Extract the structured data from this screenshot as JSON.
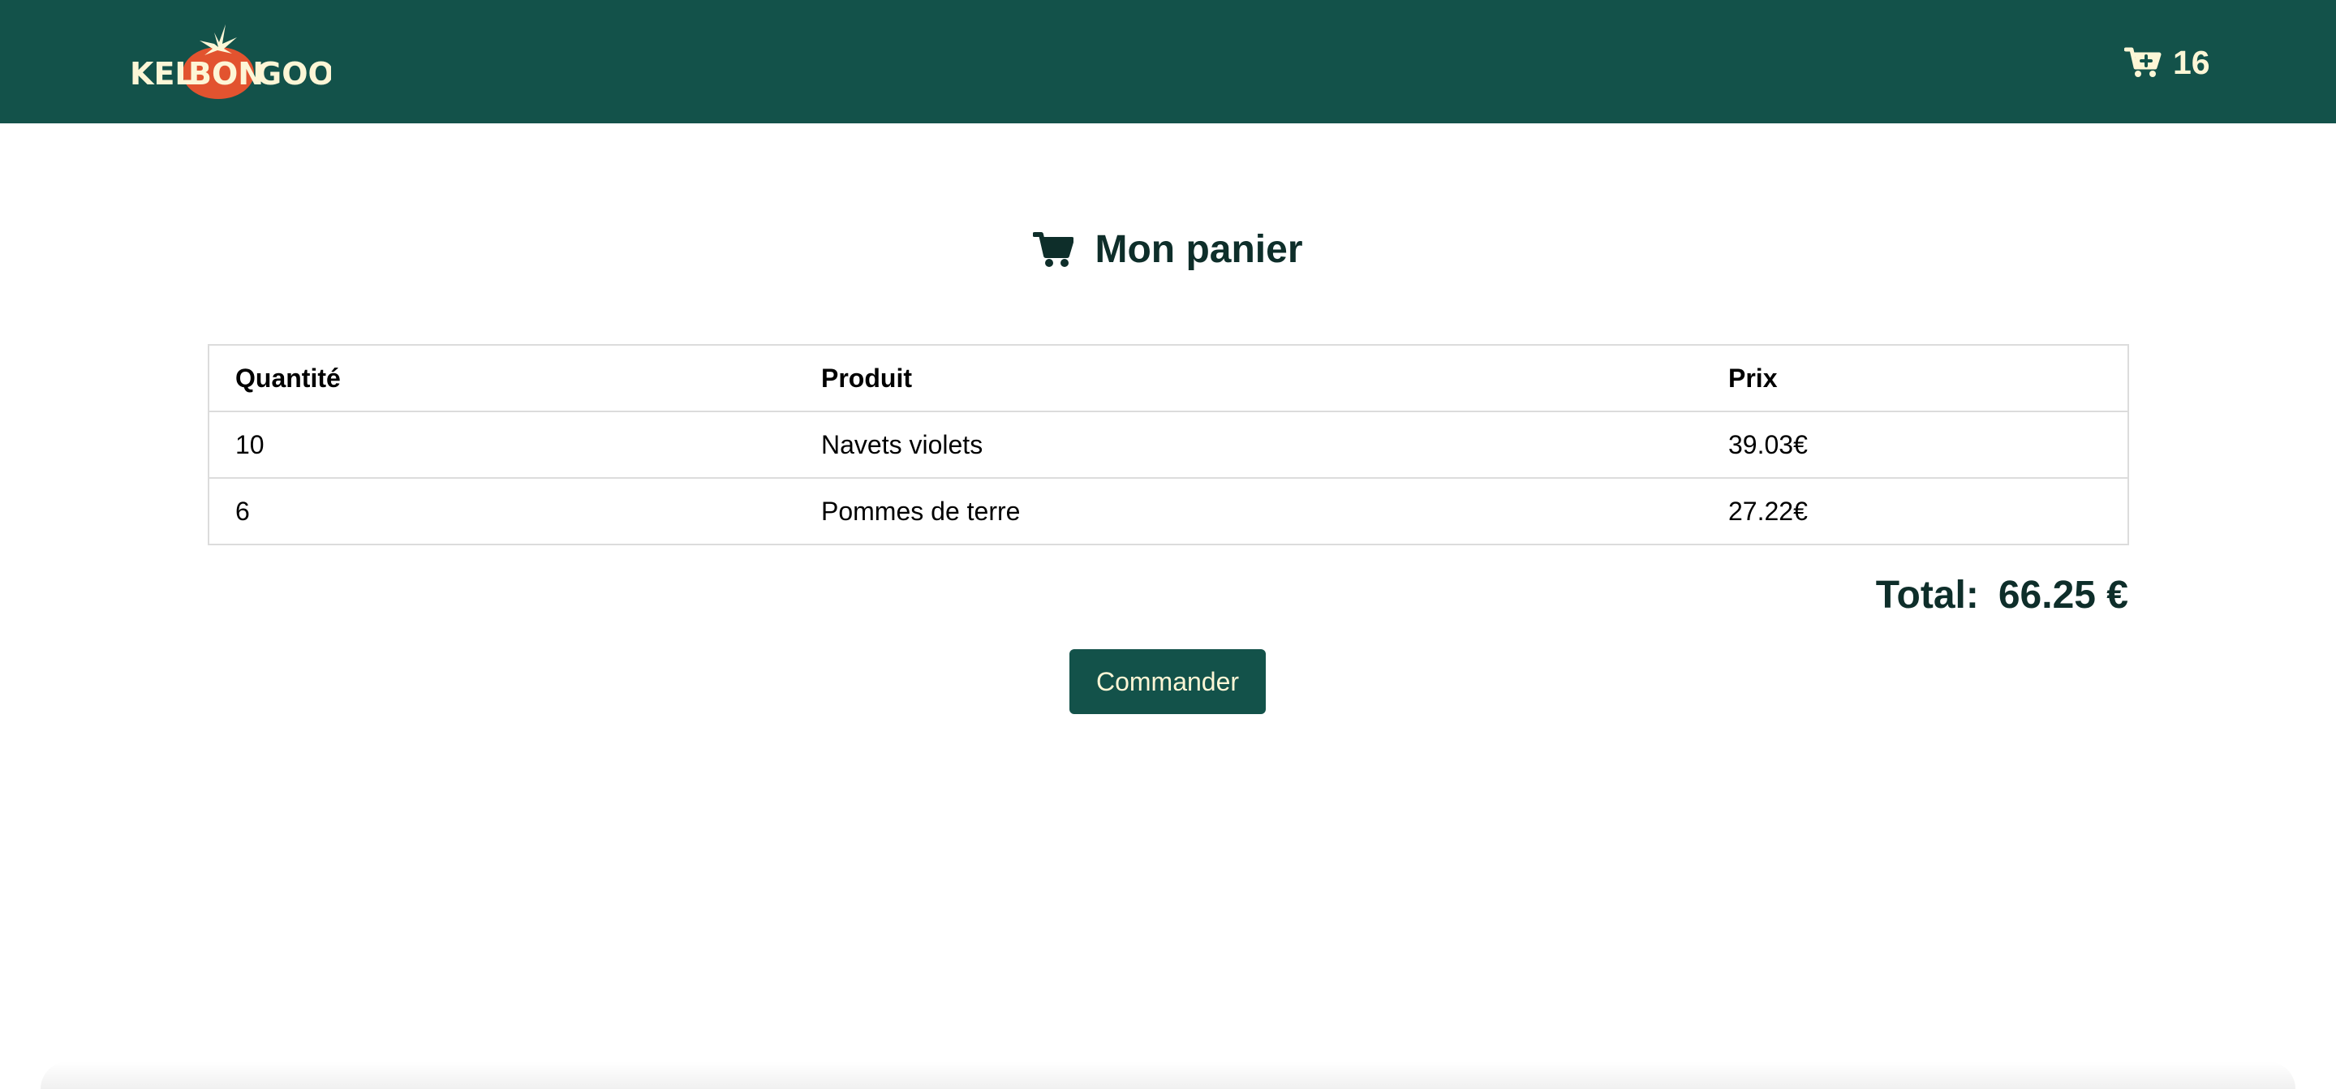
{
  "brand": {
    "logo_text_left": "KEL",
    "logo_text_middle": "BON",
    "logo_text_right": "GOO",
    "colors": {
      "primary": "#13524a",
      "cream": "#fdf6d6",
      "tomato": "#e2532f",
      "heading": "#0e2e2a"
    }
  },
  "header": {
    "cart_icon": "cart-plus-icon",
    "cart_count": "16"
  },
  "page": {
    "heading_icon": "shopping-cart-icon",
    "title": "Mon panier"
  },
  "table": {
    "headers": [
      "Quantité",
      "Produit",
      "Prix"
    ],
    "rows": [
      {
        "quantity": "10",
        "product": "Navets violets",
        "price": "39.03€"
      },
      {
        "quantity": "6",
        "product": "Pommes de terre",
        "price": "27.22€"
      }
    ]
  },
  "summary": {
    "total_label": "Total:",
    "total_value": "66.25 €"
  },
  "actions": {
    "order_label": "Commander"
  }
}
